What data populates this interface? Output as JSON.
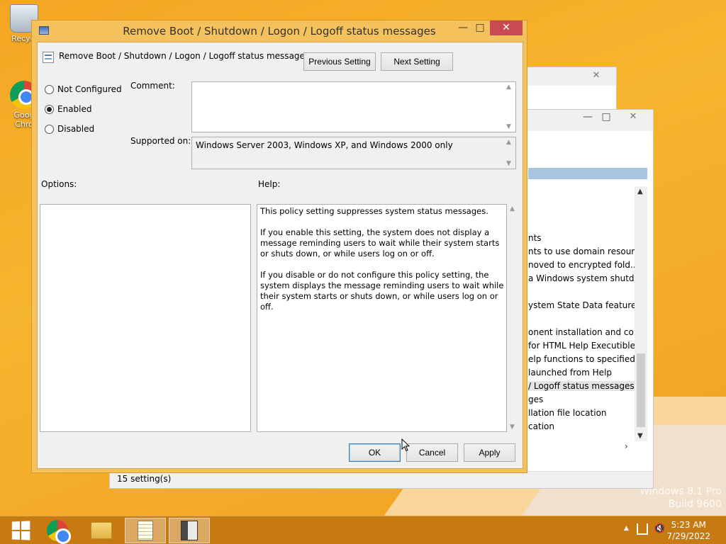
{
  "desktop": {
    "icons": [
      {
        "label": "Recycl"
      },
      {
        "label": "Goog\nChro"
      }
    ],
    "watermark": {
      "line1": "Windows 8.1 Pro",
      "line2": "Build 9600"
    }
  },
  "background_window": {
    "list_items": [
      "nts",
      "nts to use domain resour...",
      "noved to encrypted fold...",
      "a Windows system shutd...",
      "ystem State Data feature",
      "onent installation and co...",
      "for HTML Help Executible",
      "elp functions to specified...",
      "launched from Help",
      "/ Logoff status messages",
      "ges",
      "llation file location",
      "cation"
    ],
    "status": "15 setting(s)"
  },
  "dialog": {
    "title": "Remove Boot / Shutdown / Logon / Logoff status messages",
    "policy_name": "Remove Boot / Shutdown / Logon / Logoff status messages",
    "previous_setting": "Previous Setting",
    "next_setting": "Next Setting",
    "state_options": {
      "not_configured": "Not Configured",
      "enabled": "Enabled",
      "disabled": "Disabled",
      "selected": "enabled"
    },
    "comment_label": "Comment:",
    "comment_value": "",
    "supported_label": "Supported on:",
    "supported_value": "Windows Server 2003, Windows XP, and Windows 2000 only",
    "options_label": "Options:",
    "help_label": "Help:",
    "help_text": "This policy setting suppresses system status messages.\n\nIf you enable this setting, the system does not display a message reminding users to wait while their system starts or shuts down, or while users log on or off.\n\nIf you disable or do not configure this policy setting, the system displays the message reminding users to wait while their system starts or shuts down, or while users log on or off.",
    "ok": "OK",
    "cancel": "Cancel",
    "apply": "Apply"
  },
  "taskbar": {
    "time": "5:23 AM",
    "date": "7/29/2022"
  },
  "colors": {
    "desktop": "#f4a623",
    "taskbar": "#c87a12",
    "dialog_frame": "#f5c15c",
    "close_button": "#c74b50"
  }
}
